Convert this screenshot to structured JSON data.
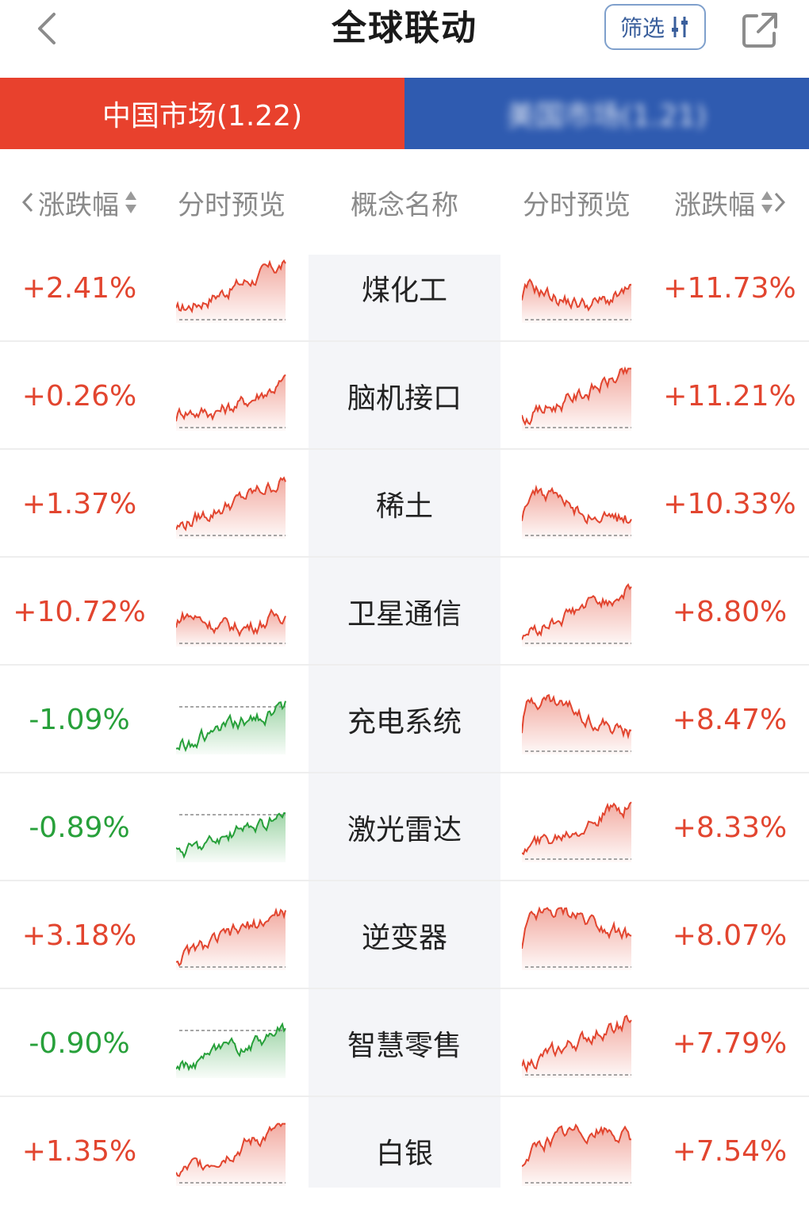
{
  "header": {
    "title": "全球联动",
    "filter_label": "筛选",
    "icons": {
      "back": "chevron-left-icon",
      "filter": "sliders-icon",
      "share": "external-link-icon"
    }
  },
  "tabs": {
    "china": "中国市场(1.22)",
    "us": "美国市场(1.21)"
  },
  "columns": {
    "left_change": "涨跌幅",
    "left_preview": "分时预览",
    "name": "概念名称",
    "right_preview": "分时预览",
    "right_change": "涨跌幅"
  },
  "colors": {
    "up": "#e2452f",
    "down": "#27a03a",
    "tab_active": "#e8412d",
    "tab_other": "#2f5bb0"
  },
  "rows": [
    {
      "name": "煤化工",
      "left": "+2.41%",
      "left_dir": "up",
      "right": "+11.73%",
      "right_dir": "up"
    },
    {
      "name": "脑机接口",
      "left": "+0.26%",
      "left_dir": "up",
      "right": "+11.21%",
      "right_dir": "up"
    },
    {
      "name": "稀土",
      "left": "+1.37%",
      "left_dir": "up",
      "right": "+10.33%",
      "right_dir": "up"
    },
    {
      "name": "卫星通信",
      "left": "+10.72%",
      "left_dir": "up",
      "right": "+8.80%",
      "right_dir": "up"
    },
    {
      "name": "充电系统",
      "left": "-1.09%",
      "left_dir": "down",
      "right": "+8.47%",
      "right_dir": "up"
    },
    {
      "name": "激光雷达",
      "left": "-0.89%",
      "left_dir": "down",
      "right": "+8.33%",
      "right_dir": "up"
    },
    {
      "name": "逆变器",
      "left": "+3.18%",
      "left_dir": "up",
      "right": "+8.07%",
      "right_dir": "up"
    },
    {
      "name": "智慧零售",
      "left": "-0.90%",
      "left_dir": "down",
      "right": "+7.79%",
      "right_dir": "up"
    },
    {
      "name": "白银",
      "left": "+1.35%",
      "left_dir": "up",
      "right": "+7.54%",
      "right_dir": "up"
    }
  ]
}
